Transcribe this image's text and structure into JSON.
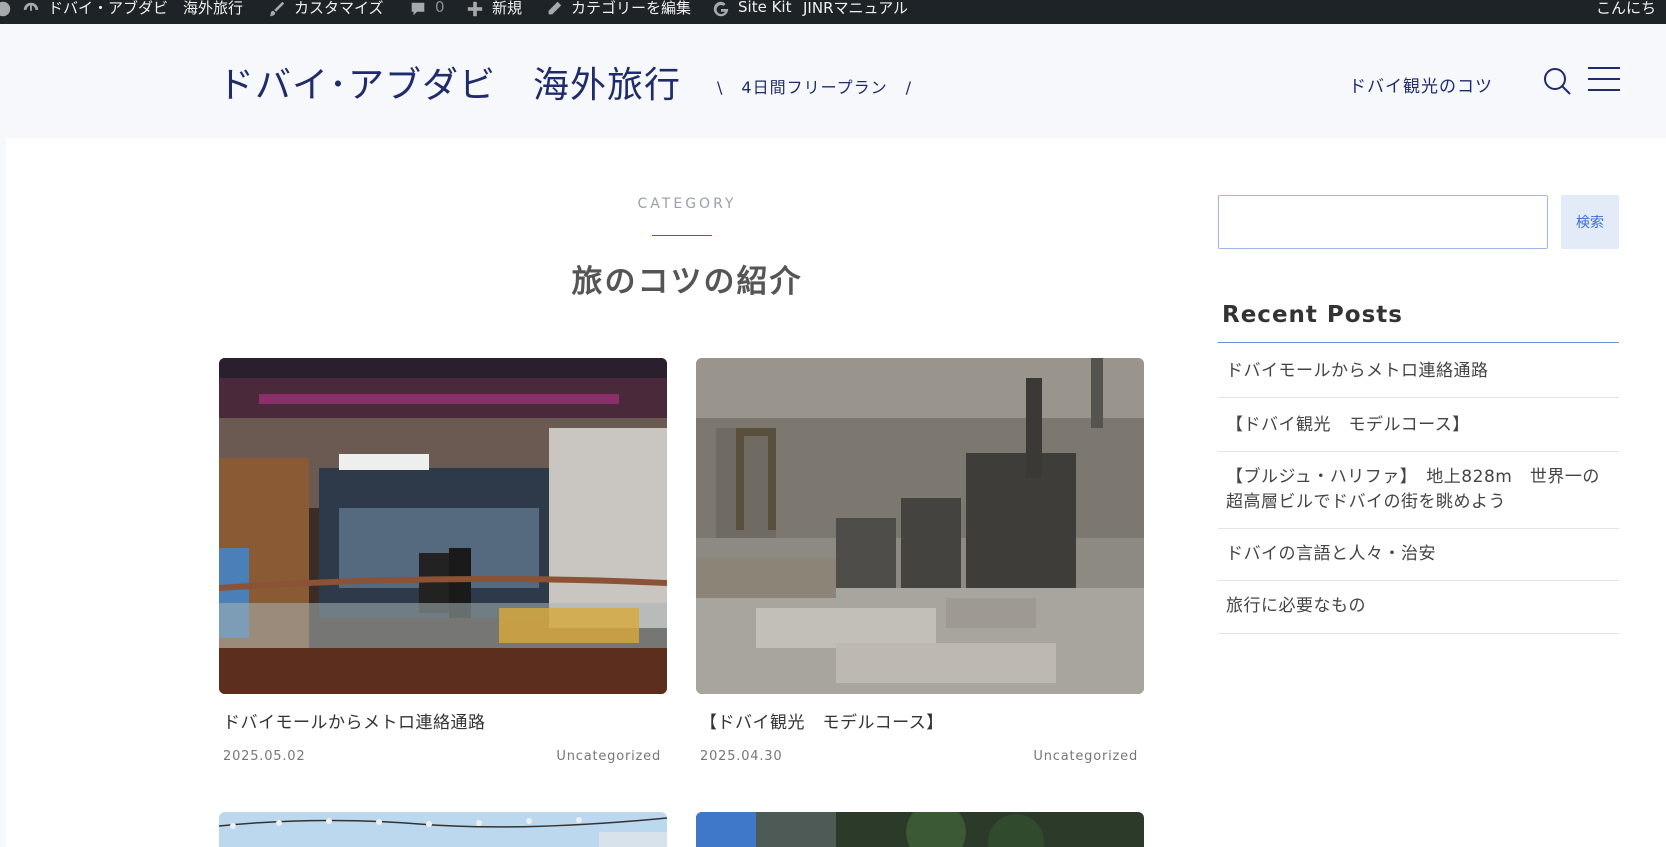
{
  "adminbar": {
    "site_name": "ドバイ・アブダビ　海外旅行",
    "customize": "カスタマイズ",
    "comments_count": "0",
    "new": "新規",
    "edit_category": "カテゴリーを編集",
    "site_kit": "Site Kit",
    "manual": "JINRマニュアル",
    "greeting": "こんにち"
  },
  "header": {
    "title": "ドバイ･アブダビ　海外旅行",
    "slash_left": "\\",
    "description": "4日間フリープラン",
    "slash_right": "/",
    "nav_link": "ドバイ観光のコツ"
  },
  "category": {
    "label": "CATEGORY",
    "title": "旅のコツの紹介"
  },
  "posts": [
    {
      "title": "ドバイモールからメトロ連絡通路",
      "date": "2025.05.02",
      "category": "Uncategorized"
    },
    {
      "title": "【ドバイ観光　モデルコース】",
      "date": "2025.04.30",
      "category": "Uncategorized"
    }
  ],
  "sidebar": {
    "search_button": "検索",
    "search_placeholder": "",
    "recent_title": "Recent Posts",
    "recent_posts": [
      "ドバイモールからメトロ連絡通路",
      "【ドバイ観光　モデルコース】",
      "【ブルジュ・ハリファ】　地上828m　世界一の超高層ビルでドバイの街を眺めよう",
      "ドバイの言語と人々・治安",
      "旅行に必要なもの"
    ]
  },
  "colors": {
    "brand": "#1f2b6b",
    "accent": "#3a6fd8",
    "adminbar": "#1d2327"
  }
}
